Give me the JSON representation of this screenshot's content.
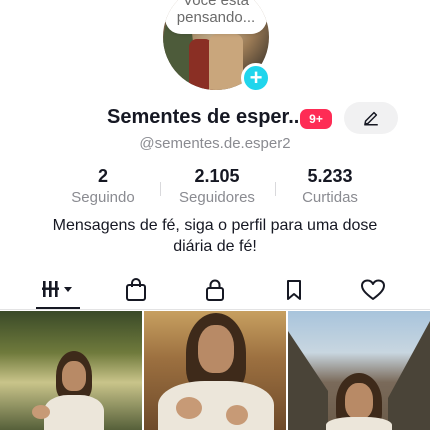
{
  "profile": {
    "avatar_thought": [
      "Você está",
      "pensando..."
    ],
    "add_symbol": "+",
    "name": "Sementes de esper...",
    "notification_badge": "9+",
    "handle": "@sementes.de.esper2",
    "bio_lines": [
      "Mensagens de fé, siga o perfil para uma dose",
      "diária de fé!"
    ]
  },
  "stats": [
    {
      "value": "2",
      "label": "Seguindo"
    },
    {
      "value": "2.105",
      "label": "Seguidores"
    },
    {
      "value": "5.233",
      "label": "Curtidas"
    }
  ],
  "tabs": [
    {
      "icon": "videos-grid-icon",
      "selected": true
    },
    {
      "icon": "shopping-bag-icon",
      "selected": false
    },
    {
      "icon": "lock-icon",
      "selected": false
    },
    {
      "icon": "bookmark-icon",
      "selected": false
    },
    {
      "icon": "heart-icon",
      "selected": false
    }
  ],
  "colors": {
    "accent": "#20d5ec",
    "badge": "#fe2c55",
    "text_primary": "#161823",
    "text_secondary": "#8a8b91"
  },
  "grid": [
    {
      "thumbnail": "video-thumbnail-1"
    },
    {
      "thumbnail": "video-thumbnail-2"
    },
    {
      "thumbnail": "video-thumbnail-3"
    }
  ]
}
